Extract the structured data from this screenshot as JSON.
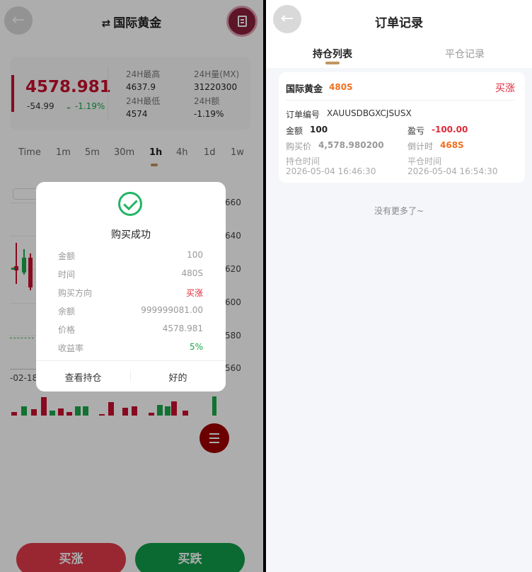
{
  "left": {
    "title": "国际黄金",
    "quote": {
      "price": "4578.981",
      "change": "-54.99",
      "percent": "-1.19%",
      "stats": [
        {
          "label": "24H最高",
          "value": "4637.9"
        },
        {
          "label": "24H量(MX)",
          "value": "31220300"
        },
        {
          "label": "24H最低",
          "value": "4574"
        },
        {
          "label": "24H额",
          "value": "-1.19%"
        }
      ]
    },
    "timeframes": [
      "Time",
      "1m",
      "5m",
      "30m",
      "1h",
      "4h",
      "1d",
      "1w"
    ],
    "active_timeframe": "1h",
    "axis": [
      "660",
      "640",
      "620",
      "600",
      "580",
      "560"
    ],
    "date_label": "-02-18",
    "buy_up": "买涨",
    "buy_down": "买跌",
    "modal": {
      "title": "购买成功",
      "rows": [
        {
          "k": "金额",
          "v": "100"
        },
        {
          "k": "时间",
          "v": "480S"
        },
        {
          "k": "购买方向",
          "v": "买涨"
        },
        {
          "k": "余额",
          "v": "999999081.00"
        },
        {
          "k": "价格",
          "v": "4578.981"
        },
        {
          "k": "收益率",
          "v": "5%"
        }
      ],
      "btn_view": "查看持仓",
      "btn_ok": "好的"
    }
  },
  "right": {
    "title": "订单记录",
    "tabs": [
      "持仓列表",
      "平仓记录"
    ],
    "order": {
      "name": "国际黄金",
      "duration": "480S",
      "direction": "买涨",
      "order_no_label": "订单编号",
      "order_no": "XAUUSDBGXCJSUSX",
      "amount_label": "金额",
      "amount": "100",
      "pnl_label": "盈亏",
      "pnl": "-100.00",
      "buy_price_label": "购买价",
      "buy_price": "4,578.980200",
      "countdown_label": "倒计时",
      "countdown": "468S",
      "open_time_label": "持仓时间",
      "open_time": "2026-05-04 16:46:30",
      "close_time_label": "平仓时间",
      "close_time": "2026-05-04 16:54:30"
    },
    "no_more": "没有更多了~"
  },
  "colors": {
    "red": "#e02a3a",
    "green": "#1aa84a",
    "orange": "#f07020",
    "gold": "#c09560"
  }
}
